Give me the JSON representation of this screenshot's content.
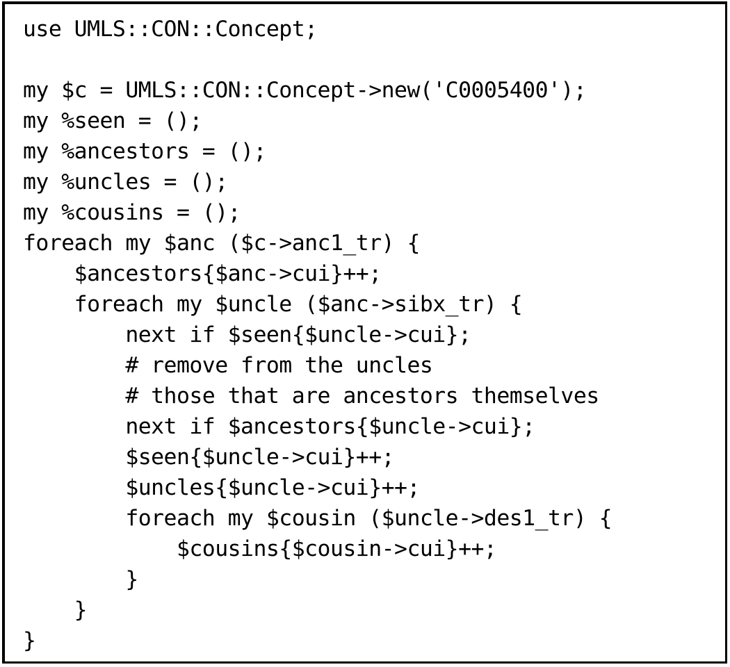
{
  "figure": {
    "kind": "code-listing",
    "language": "Perl",
    "background_color": "#ffffff",
    "text_color": "#000000",
    "border_color": "#000000"
  },
  "code": {
    "indent_unit": "    ",
    "lines": [
      "use UMLS::CON::Concept;",
      "",
      "my $c = UMLS::CON::Concept->new('C0005400');",
      "my %seen = ();",
      "my %ancestors = ();",
      "my %uncles = ();",
      "my %cousins = ();",
      "foreach my $anc ($c->anc1_tr) {",
      "    $ancestors{$anc->cui}++;",
      "    foreach my $uncle ($anc->sibx_tr) {",
      "        next if $seen{$uncle->cui};",
      "        # remove from the uncles",
      "        # those that are ancestors themselves",
      "        next if $ancestors{$uncle->cui};",
      "        $seen{$uncle->cui}++;",
      "        $uncles{$uncle->cui}++;",
      "        foreach my $cousin ($uncle->des1_tr) {",
      "            $cousins{$cousin->cui}++;",
      "        }",
      "    }",
      "}"
    ]
  }
}
